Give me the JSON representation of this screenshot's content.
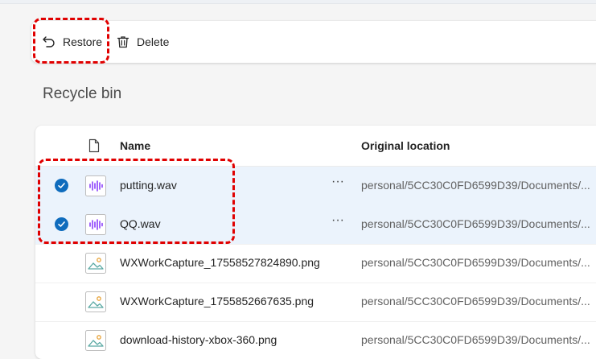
{
  "toolbar": {
    "restore_label": "Restore",
    "delete_label": "Delete"
  },
  "page": {
    "title": "Recycle bin"
  },
  "table": {
    "columns": [
      "Name",
      "Original location"
    ],
    "rows": [
      {
        "name": "putting.wav",
        "type": "audio",
        "location": "personal/5CC30C0FD6599D39/Documents/...",
        "selected": true,
        "more": "···"
      },
      {
        "name": "QQ.wav",
        "type": "audio",
        "location": "personal/5CC30C0FD6599D39/Documents/...",
        "selected": true,
        "more": "···"
      },
      {
        "name": "WXWorkCapture_17558527824890.png",
        "type": "image",
        "location": "personal/5CC30C0FD6599D39/Documents/...",
        "selected": false
      },
      {
        "name": "WXWorkCapture_1755852667635.png",
        "type": "image",
        "location": "personal/5CC30C0FD6599D39/Documents/...",
        "selected": false
      },
      {
        "name": "download-history-xbox-360.png",
        "type": "image",
        "location": "personal/5CC30C0FD6599D39/Documents/...",
        "selected": false
      }
    ]
  },
  "icons": {
    "restore": "undo-arrow-icon",
    "delete": "trash-icon",
    "header_file": "file-icon",
    "audio": "audio-file-icon",
    "image": "image-file-icon",
    "check": "checkmark-circle-icon"
  },
  "colors": {
    "accent": "#0f6cbd",
    "selected_row": "#ebf3fc",
    "audio_icon": "#8a3ffc",
    "annotation": "#e00000"
  }
}
